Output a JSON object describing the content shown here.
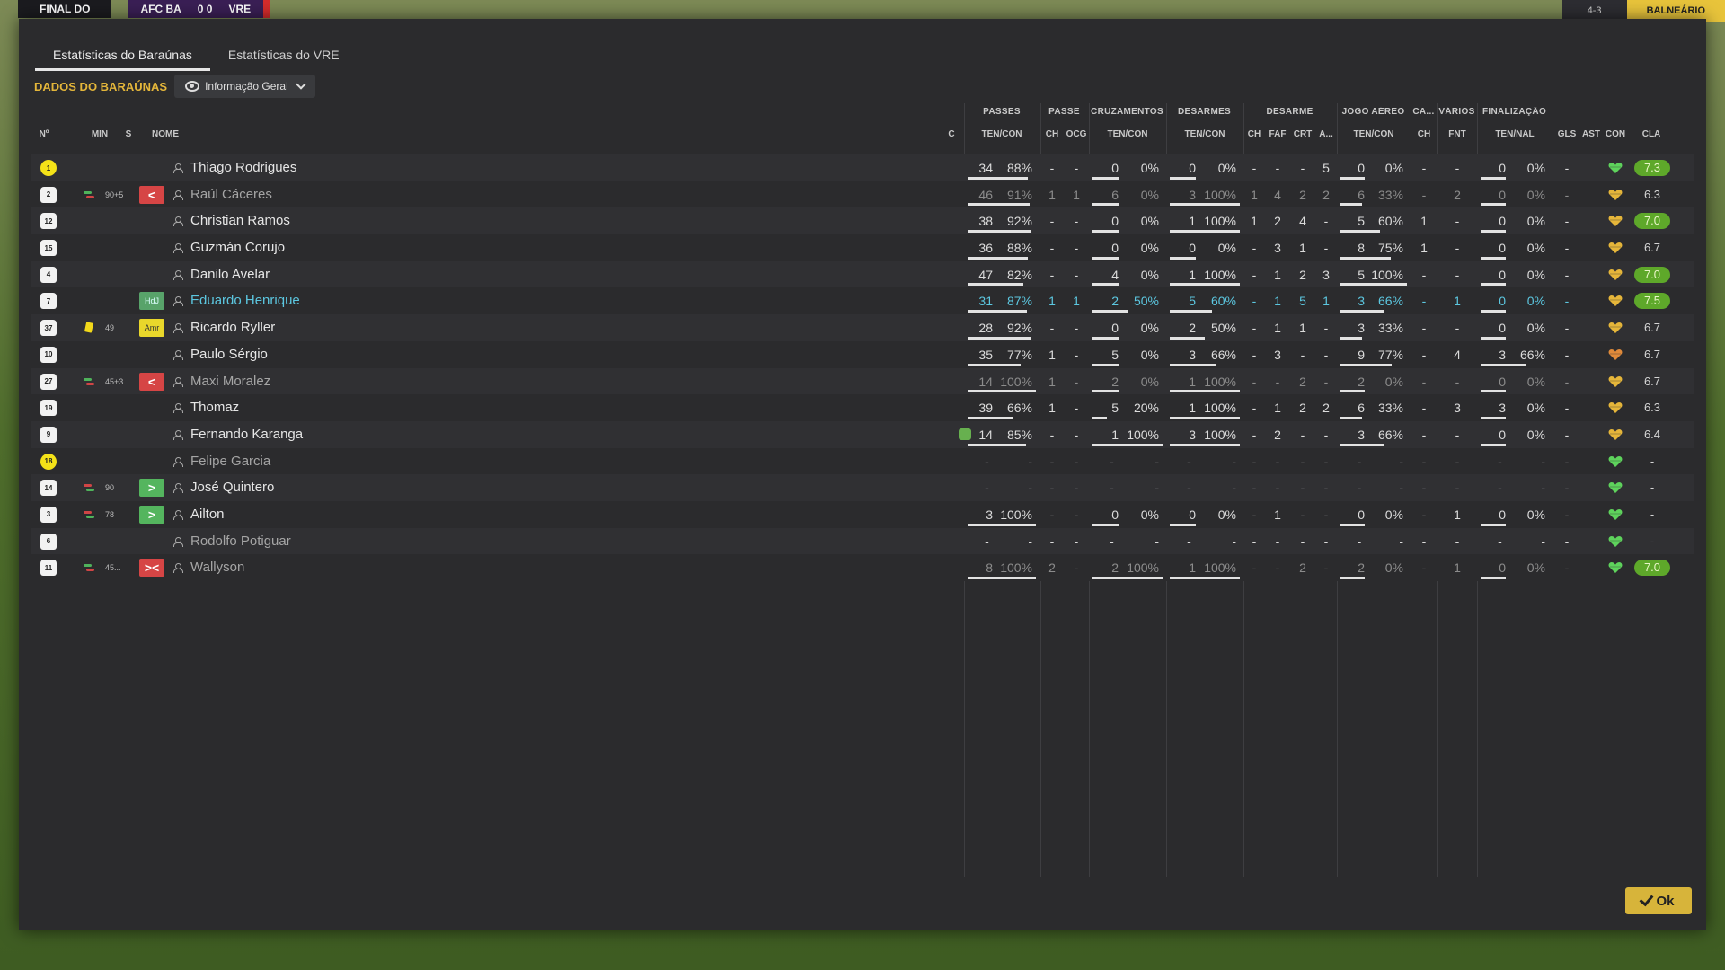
{
  "scoreboard": {
    "stage": "FINAL DO",
    "home": "AFC BA",
    "score": "0 0",
    "away": "VRE",
    "mini": "4-3",
    "balneario": "BALNEÁRIO"
  },
  "tabs": [
    "Estatísticas do Baraúnas",
    "Estatísticas do VRE"
  ],
  "team_label": "DADOS DO BARAÚNAS",
  "view_select": "Informação Geral",
  "group_headers": [
    "PASSES",
    "PASSE",
    "CRUZAMENTOS",
    "DESARMES",
    "DESARME",
    "JOGO AÉREO",
    "CA...",
    "VÁRIOS",
    "FINALIZAÇÃO"
  ],
  "column_headers": {
    "num": "Nº",
    "min": "MIN",
    "s": "S",
    "name": "NOME",
    "c": "C",
    "passes": "TEN/CON",
    "pch": "CH",
    "pocg": "OCG",
    "cruz": "TEN/CON",
    "des": "TEN/CON",
    "dch": "CH",
    "dfaf": "FAF",
    "dcrt": "CRT",
    "da": "A...",
    "aer": "TEN/CON",
    "cach": "CH",
    "fnt": "FNT",
    "fin": "TEN/NAL",
    "gls": "GLS",
    "ast": "AST",
    "con": "CON",
    "cla": "CLA"
  },
  "players": [
    {
      "num": "1",
      "gk": true,
      "min": "",
      "sub": "",
      "badge": "",
      "badge_text": "",
      "name": "Thiago Rodrigues",
      "style": "",
      "cond": false,
      "passes": [
        "34",
        "88%",
        88
      ],
      "pch": "-",
      "pocg": "-",
      "cruz": [
        "0",
        "0%",
        0
      ],
      "des": [
        "0",
        "0%",
        0
      ],
      "dch": "-",
      "dfaf": "-",
      "dcrt": "-",
      "da": "5",
      "aer": [
        "0",
        "0%",
        0
      ],
      "cach": "-",
      "fnt": "-",
      "fin": [
        "0",
        "0%",
        0
      ],
      "gls": "-",
      "heart": "green",
      "rating": "7.3",
      "hi": true
    },
    {
      "num": "2",
      "gk": false,
      "min": "90+5",
      "sub": "out",
      "badge": "out",
      "badge_text": "<",
      "name": "Raúl Cáceres",
      "style": "dim",
      "cond": false,
      "passes": [
        "46",
        "91%",
        91
      ],
      "pch": "1",
      "pocg": "1",
      "cruz": [
        "6",
        "0%",
        0
      ],
      "des": [
        "3",
        "100%",
        100
      ],
      "dch": "1",
      "dfaf": "4",
      "dcrt": "2",
      "da": "2",
      "aer": [
        "6",
        "33%",
        33
      ],
      "cach": "-",
      "fnt": "2",
      "fin": [
        "0",
        "0%",
        0
      ],
      "gls": "-",
      "heart": "gold",
      "rating": "6.3",
      "hi": false,
      "muted": true
    },
    {
      "num": "12",
      "gk": false,
      "min": "",
      "sub": "",
      "badge": "",
      "badge_text": "",
      "name": "Christian Ramos",
      "style": "",
      "cond": false,
      "passes": [
        "38",
        "92%",
        92
      ],
      "pch": "-",
      "pocg": "-",
      "cruz": [
        "0",
        "0%",
        0
      ],
      "des": [
        "1",
        "100%",
        100
      ],
      "dch": "1",
      "dfaf": "2",
      "dcrt": "4",
      "da": "-",
      "aer": [
        "5",
        "60%",
        60
      ],
      "cach": "1",
      "fnt": "-",
      "fin": [
        "0",
        "0%",
        0
      ],
      "gls": "-",
      "heart": "gold",
      "rating": "7.0",
      "hi": true
    },
    {
      "num": "15",
      "gk": false,
      "min": "",
      "sub": "",
      "badge": "",
      "badge_text": "",
      "name": "Guzmán Corujo",
      "style": "",
      "cond": false,
      "passes": [
        "36",
        "88%",
        88
      ],
      "pch": "-",
      "pocg": "-",
      "cruz": [
        "0",
        "0%",
        0
      ],
      "des": [
        "0",
        "0%",
        0
      ],
      "dch": "-",
      "dfaf": "3",
      "dcrt": "1",
      "da": "-",
      "aer": [
        "8",
        "75%",
        75
      ],
      "cach": "1",
      "fnt": "-",
      "fin": [
        "0",
        "0%",
        0
      ],
      "gls": "-",
      "heart": "gold",
      "rating": "6.7",
      "hi": false
    },
    {
      "num": "4",
      "gk": false,
      "min": "",
      "sub": "",
      "badge": "",
      "badge_text": "",
      "name": "Danilo Avelar",
      "style": "",
      "cond": false,
      "passes": [
        "47",
        "82%",
        82
      ],
      "pch": "-",
      "pocg": "-",
      "cruz": [
        "4",
        "0%",
        0
      ],
      "des": [
        "1",
        "100%",
        100
      ],
      "dch": "-",
      "dfaf": "1",
      "dcrt": "2",
      "da": "3",
      "aer": [
        "5",
        "100%",
        100
      ],
      "cach": "-",
      "fnt": "-",
      "fin": [
        "0",
        "0%",
        0
      ],
      "gls": "-",
      "heart": "gold",
      "rating": "7.0",
      "hi": true
    },
    {
      "num": "7",
      "gk": false,
      "min": "",
      "sub": "",
      "badge": "hdj",
      "badge_text": "HdJ",
      "name": "Eduardo Henrique",
      "style": "hl",
      "cond": false,
      "passes": [
        "31",
        "87%",
        87
      ],
      "pch": "1",
      "pocg": "1",
      "cruz": [
        "2",
        "50%",
        50
      ],
      "des": [
        "5",
        "60%",
        60
      ],
      "dch": "-",
      "dfaf": "1",
      "dcrt": "5",
      "da": "1",
      "aer": [
        "3",
        "66%",
        66
      ],
      "cach": "-",
      "fnt": "1",
      "fin": [
        "0",
        "0%",
        0
      ],
      "gls": "-",
      "heart": "gold",
      "rating": "7.5",
      "hi": true,
      "blue": true
    },
    {
      "num": "37",
      "gk": false,
      "min": "49",
      "sub": "card",
      "badge": "amr",
      "badge_text": "Amr",
      "name": "Ricardo Ryller",
      "style": "",
      "cond": false,
      "passes": [
        "28",
        "92%",
        92
      ],
      "pch": "-",
      "pocg": "-",
      "cruz": [
        "0",
        "0%",
        0
      ],
      "des": [
        "2",
        "50%",
        50
      ],
      "dch": "-",
      "dfaf": "1",
      "dcrt": "1",
      "da": "-",
      "aer": [
        "3",
        "33%",
        33
      ],
      "cach": "-",
      "fnt": "-",
      "fin": [
        "0",
        "0%",
        0
      ],
      "gls": "-",
      "heart": "gold",
      "rating": "6.7",
      "hi": false
    },
    {
      "num": "10",
      "gk": false,
      "min": "",
      "sub": "",
      "badge": "",
      "badge_text": "",
      "name": "Paulo Sérgio",
      "style": "",
      "cond": false,
      "passes": [
        "35",
        "77%",
        77
      ],
      "pch": "1",
      "pocg": "-",
      "cruz": [
        "5",
        "0%",
        0
      ],
      "des": [
        "3",
        "66%",
        66
      ],
      "dch": "-",
      "dfaf": "3",
      "dcrt": "-",
      "da": "-",
      "aer": [
        "9",
        "77%",
        77
      ],
      "cach": "-",
      "fnt": "4",
      "fin": [
        "3",
        "66%",
        66
      ],
      "gls": "-",
      "heart": "orange",
      "rating": "6.7",
      "hi": false
    },
    {
      "num": "27",
      "gk": false,
      "min": "45+3",
      "sub": "out",
      "badge": "out",
      "badge_text": "<",
      "name": "Maxi Moralez",
      "style": "dim",
      "cond": false,
      "passes": [
        "14",
        "100%",
        100
      ],
      "pch": "1",
      "pocg": "-",
      "cruz": [
        "2",
        "0%",
        0
      ],
      "des": [
        "1",
        "100%",
        100
      ],
      "dch": "-",
      "dfaf": "-",
      "dcrt": "2",
      "da": "-",
      "aer": [
        "2",
        "0%",
        0
      ],
      "cach": "-",
      "fnt": "-",
      "fin": [
        "0",
        "0%",
        0
      ],
      "gls": "-",
      "heart": "gold",
      "rating": "6.7",
      "hi": false,
      "muted": true
    },
    {
      "num": "19",
      "gk": false,
      "min": "",
      "sub": "",
      "badge": "",
      "badge_text": "",
      "name": "Thomaz",
      "style": "",
      "cond": false,
      "passes": [
        "39",
        "66%",
        66
      ],
      "pch": "1",
      "pocg": "-",
      "cruz": [
        "5",
        "20%",
        20
      ],
      "des": [
        "1",
        "100%",
        100
      ],
      "dch": "-",
      "dfaf": "1",
      "dcrt": "2",
      "da": "2",
      "aer": [
        "6",
        "33%",
        33
      ],
      "cach": "-",
      "fnt": "3",
      "fin": [
        "3",
        "0%",
        0
      ],
      "gls": "-",
      "heart": "gold",
      "rating": "6.3",
      "hi": false
    },
    {
      "num": "9",
      "gk": false,
      "min": "",
      "sub": "",
      "badge": "",
      "badge_text": "",
      "name": "Fernando Karanga",
      "style": "",
      "cond": true,
      "passes": [
        "14",
        "85%",
        85
      ],
      "pch": "-",
      "pocg": "-",
      "cruz": [
        "1",
        "100%",
        100
      ],
      "des": [
        "3",
        "100%",
        100
      ],
      "dch": "-",
      "dfaf": "2",
      "dcrt": "-",
      "da": "-",
      "aer": [
        "3",
        "66%",
        66
      ],
      "cach": "-",
      "fnt": "-",
      "fin": [
        "0",
        "0%",
        0
      ],
      "gls": "-",
      "heart": "gold",
      "rating": "6.4",
      "hi": false
    },
    {
      "num": "18",
      "gk": true,
      "min": "",
      "sub": "",
      "badge": "",
      "badge_text": "",
      "name": "Felipe Garcia",
      "style": "dim",
      "cond": false,
      "passes": [
        "-",
        "-",
        -1
      ],
      "pch": "-",
      "pocg": "-",
      "cruz": [
        "-",
        "-",
        -1
      ],
      "des": [
        "-",
        "-",
        -1
      ],
      "dch": "-",
      "dfaf": "-",
      "dcrt": "-",
      "da": "-",
      "aer": [
        "-",
        "-",
        -1
      ],
      "cach": "-",
      "fnt": "-",
      "fin": [
        "-",
        "-",
        -1
      ],
      "gls": "-",
      "heart": "green",
      "rating": "-",
      "hi": false
    },
    {
      "num": "14",
      "gk": false,
      "min": "90",
      "sub": "in",
      "badge": "in",
      "badge_text": ">",
      "name": "José Quintero",
      "style": "",
      "cond": false,
      "passes": [
        "-",
        "-",
        -1
      ],
      "pch": "-",
      "pocg": "-",
      "cruz": [
        "-",
        "-",
        -1
      ],
      "des": [
        "-",
        "-",
        -1
      ],
      "dch": "-",
      "dfaf": "-",
      "dcrt": "-",
      "da": "-",
      "aer": [
        "-",
        "-",
        -1
      ],
      "cach": "-",
      "fnt": "-",
      "fin": [
        "-",
        "-",
        -1
      ],
      "gls": "-",
      "heart": "green",
      "rating": "-",
      "hi": false
    },
    {
      "num": "3",
      "gk": false,
      "min": "78",
      "sub": "in",
      "badge": "in",
      "badge_text": ">",
      "name": "Ailton",
      "style": "",
      "cond": false,
      "passes": [
        "3",
        "100%",
        100
      ],
      "pch": "-",
      "pocg": "-",
      "cruz": [
        "0",
        "0%",
        0
      ],
      "des": [
        "0",
        "0%",
        0
      ],
      "dch": "-",
      "dfaf": "1",
      "dcrt": "-",
      "da": "-",
      "aer": [
        "0",
        "0%",
        0
      ],
      "cach": "-",
      "fnt": "1",
      "fin": [
        "0",
        "0%",
        0
      ],
      "gls": "-",
      "heart": "green",
      "rating": "-",
      "hi": false
    },
    {
      "num": "6",
      "gk": false,
      "min": "",
      "sub": "",
      "badge": "",
      "badge_text": "",
      "name": "Rodolfo Potiguar",
      "style": "dim",
      "cond": false,
      "passes": [
        "-",
        "-",
        -1
      ],
      "pch": "-",
      "pocg": "-",
      "cruz": [
        "-",
        "-",
        -1
      ],
      "des": [
        "-",
        "-",
        -1
      ],
      "dch": "-",
      "dfaf": "-",
      "dcrt": "-",
      "da": "-",
      "aer": [
        "-",
        "-",
        -1
      ],
      "cach": "-",
      "fnt": "-",
      "fin": [
        "-",
        "-",
        -1
      ],
      "gls": "-",
      "heart": "green",
      "rating": "-",
      "hi": false
    },
    {
      "num": "11",
      "gk": false,
      "min": "45...",
      "sub": "out",
      "badge": "inout",
      "badge_text": "><",
      "name": "Wallyson",
      "style": "dim",
      "cond": false,
      "passes": [
        "8",
        "100%",
        100
      ],
      "pch": "2",
      "pocg": "-",
      "cruz": [
        "2",
        "100%",
        100
      ],
      "des": [
        "1",
        "100%",
        100
      ],
      "dch": "-",
      "dfaf": "-",
      "dcrt": "2",
      "da": "-",
      "aer": [
        "2",
        "0%",
        0
      ],
      "cach": "-",
      "fnt": "1",
      "fin": [
        "0",
        "0%",
        0
      ],
      "gls": "-",
      "heart": "green",
      "rating": "7.0",
      "hi": true,
      "muted": true
    }
  ],
  "ok_label": "Ok",
  "colors": {
    "accent": "#d7b43a",
    "team_label": "#e4b63a",
    "rating_high": "#5ea82a",
    "highlight_name": "#5cc7e0"
  }
}
